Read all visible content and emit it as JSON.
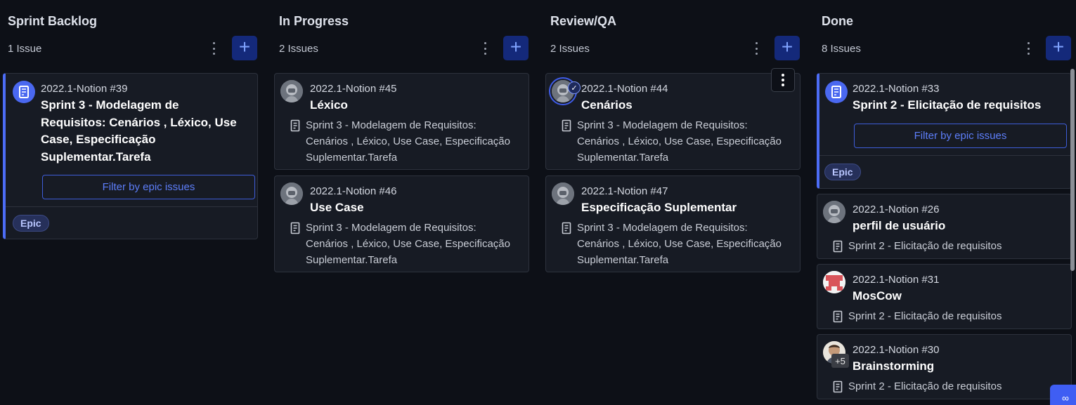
{
  "columns": [
    {
      "title": "Sprint Backlog",
      "count": "1 Issue",
      "cards": [
        {
          "ref": "2022.1-Notion #39",
          "title": "Sprint 3 - Modelagem de Requisitos: Cenários , Léxico, Use Case, Especificação Suplementar.Tarefa",
          "filter_label": "Filter by epic issues",
          "badge": "Epic"
        }
      ]
    },
    {
      "title": "In Progress",
      "count": "2 Issues",
      "cards": [
        {
          "ref": "2022.1-Notion #45",
          "title": "Léxico",
          "epic": "Sprint 3 - Modelagem de Requisitos: Cenários , Léxico, Use Case, Especificação Suplementar.Tarefa"
        },
        {
          "ref": "2022.1-Notion #46",
          "title": "Use Case",
          "epic": "Sprint 3 - Modelagem de Requisitos: Cenários , Léxico, Use Case, Especificação Suplementar.Tarefa"
        }
      ]
    },
    {
      "title": "Review/QA",
      "count": "2 Issues",
      "cards": [
        {
          "ref": "2022.1-Notion #44",
          "title": "Cenários",
          "epic": "Sprint 3 - Modelagem de Requisitos: Cenários , Léxico, Use Case, Especificação Suplementar.Tarefa"
        },
        {
          "ref": "2022.1-Notion #47",
          "title": "Especificação Suplementar",
          "epic": "Sprint 3 - Modelagem de Requisitos: Cenários , Léxico, Use Case, Especificação Suplementar.Tarefa"
        }
      ]
    },
    {
      "title": "Done",
      "count": "8 Issues",
      "cards": [
        {
          "ref": "2022.1-Notion #33",
          "title": "Sprint 2 - Elicitação de requisitos",
          "filter_label": "Filter by epic issues",
          "badge": "Epic"
        },
        {
          "ref": "2022.1-Notion #26",
          "title": "perfil de usuário",
          "epic": "Sprint 2 - Elicitação de requisitos"
        },
        {
          "ref": "2022.1-Notion #31",
          "title": "MosCow",
          "epic": "Sprint 2 - Elicitação de requisitos"
        },
        {
          "ref": "2022.1-Notion #30",
          "title": "Brainstorming",
          "epic": "Sprint 2 - Elicitação de requisitos",
          "assignee_extra": "+5"
        }
      ]
    }
  ],
  "colors": {
    "accent": "#4c6cf5",
    "background": "#0d1017",
    "card": "#171b24"
  }
}
